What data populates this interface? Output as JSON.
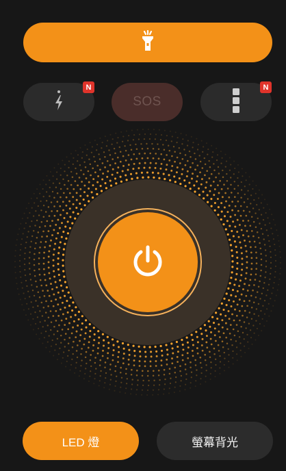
{
  "header": {
    "icon": "flashlight-icon"
  },
  "modes": {
    "flash": {
      "icon": "flash-bolt-icon",
      "badge": "N"
    },
    "sos": {
      "label": "SOS"
    },
    "more": {
      "icon": "light-blocks-icon",
      "badge": "N"
    }
  },
  "main": {
    "icon": "power-icon"
  },
  "bottom": {
    "led_label": "LED 燈",
    "screen_label": "螢幕背光"
  },
  "colors": {
    "accent": "#f39118",
    "background": "#171717",
    "button_dark": "#2b2b2b",
    "sos_bg": "#4a2d2a",
    "badge": "#e0342b",
    "dot": "#f3a22e"
  }
}
